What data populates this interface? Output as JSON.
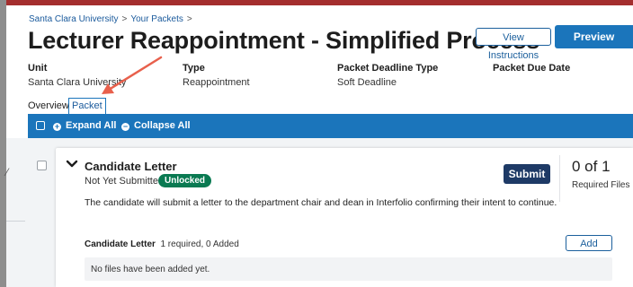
{
  "breadcrumb": {
    "items": [
      "Santa Clara University",
      "Your Packets"
    ],
    "separator": ">"
  },
  "page": {
    "title": "Lecturer Reappointment - Simplified Process"
  },
  "actions": {
    "view_instructions": "View Instructions",
    "preview_packet": "Preview Packet"
  },
  "meta": {
    "unit_label": "Unit",
    "unit_value": "Santa Clara University",
    "type_label": "Type",
    "type_value": "Reappointment",
    "deadline_type_label": "Packet Deadline Type",
    "deadline_type_value": "Soft Deadline",
    "due_date_label": "Packet Due Date",
    "due_date_value": ""
  },
  "tabs": {
    "overview": "Overview",
    "packet": "Packet",
    "active": "Packet"
  },
  "toolbar": {
    "expand_all": "Expand All",
    "collapse_all": "Collapse All"
  },
  "section": {
    "title": "Candidate Letter",
    "status": "Not Yet Submitted",
    "badge": "Unlocked",
    "submit_label": "Submit",
    "count": "0 of 1",
    "count_label": "Required Files",
    "description": "The candidate will submit a letter to the department chair and dean in Interfolio confirming their intent to continue.",
    "requirement_name": "Candidate Letter",
    "requirement_detail": "1 required, 0 Added",
    "add_label": "Add",
    "empty_message": "No files have been added yet."
  },
  "colors": {
    "accent": "#1b75bb",
    "submit": "#1e3a66",
    "badge": "#0a7a52",
    "annotation_arrow": "#e8604c"
  }
}
